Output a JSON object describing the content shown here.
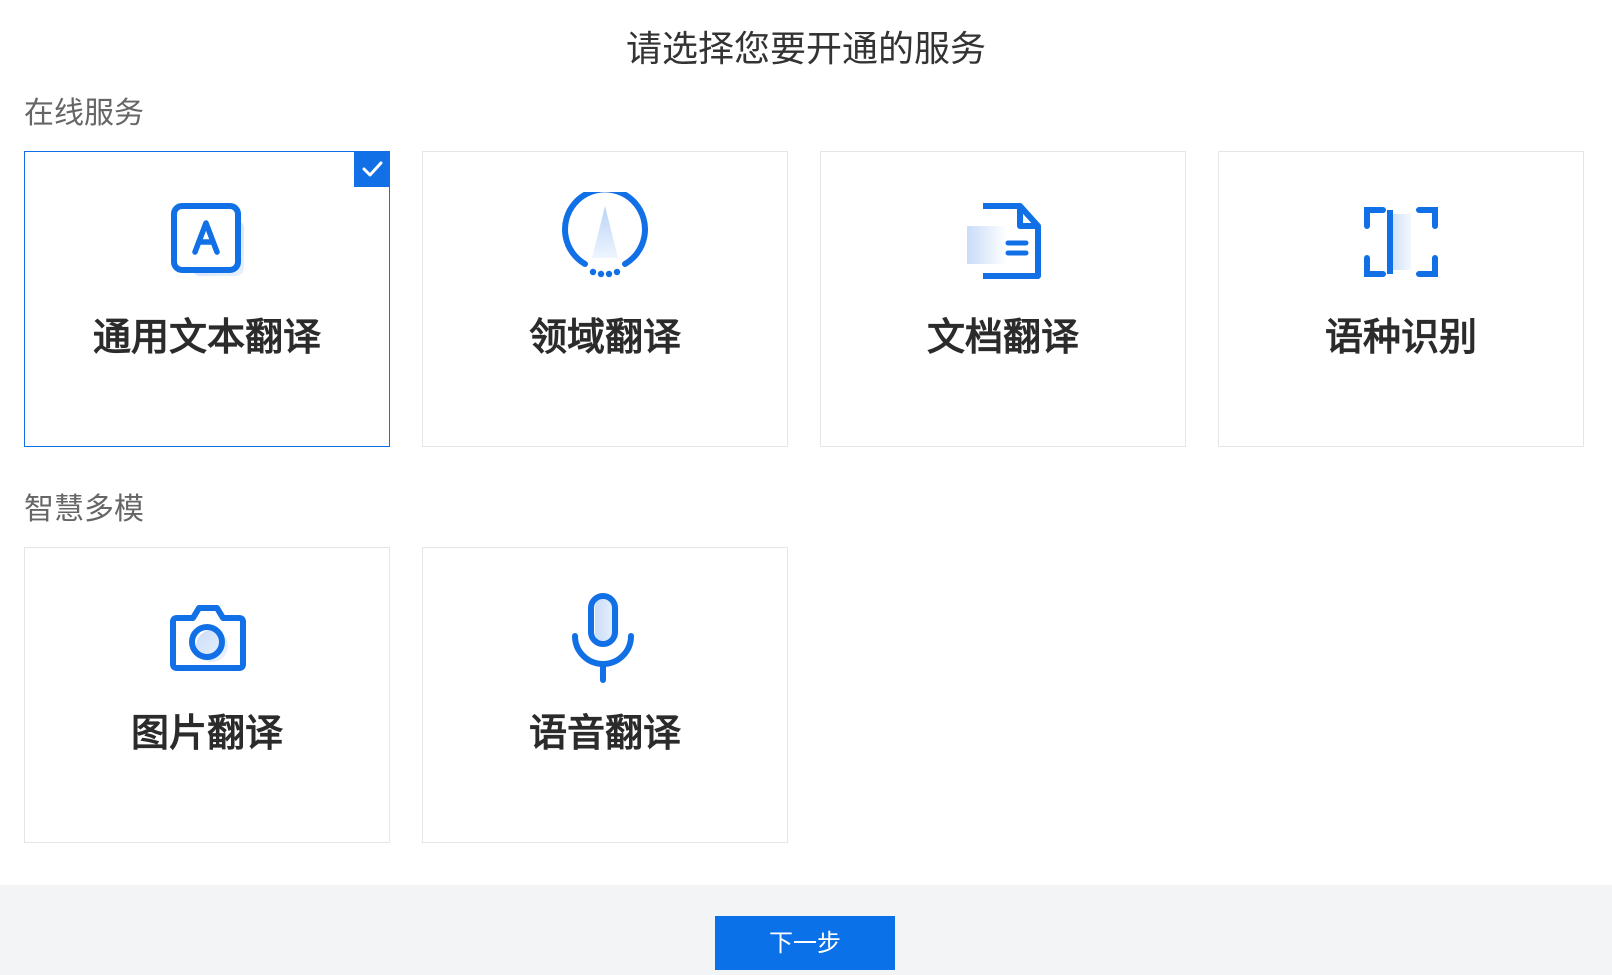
{
  "page": {
    "title": "请选择您要开通的服务"
  },
  "sections": [
    {
      "title": "在线服务",
      "cards": [
        {
          "label": "通用文本翻译",
          "icon": "text-translate-icon",
          "selected": true
        },
        {
          "label": "领域翻译",
          "icon": "domain-compass-icon",
          "selected": false
        },
        {
          "label": "文档翻译",
          "icon": "document-icon",
          "selected": false
        },
        {
          "label": "语种识别",
          "icon": "scan-frame-icon",
          "selected": false
        }
      ]
    },
    {
      "title": "智慧多模",
      "cards": [
        {
          "label": "图片翻译",
          "icon": "camera-icon",
          "selected": false
        },
        {
          "label": "语音翻译",
          "icon": "microphone-icon",
          "selected": false
        }
      ]
    }
  ],
  "footer": {
    "next_label": "下一步"
  },
  "colors": {
    "accent": "#1170e6",
    "button": "#0b71e8",
    "footer_bg": "#f3f4f6",
    "title_text": "#333333",
    "section_text": "#666666"
  }
}
